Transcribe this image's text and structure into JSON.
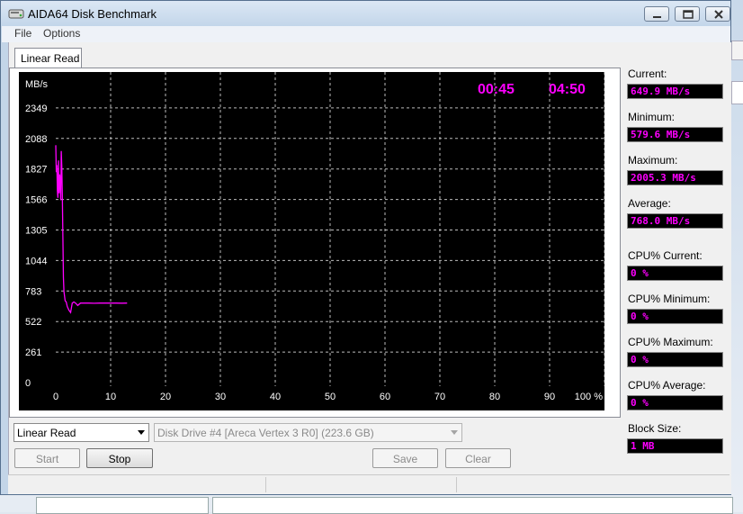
{
  "window": {
    "title": "AIDA64 Disk Benchmark"
  },
  "menu": {
    "file": "File",
    "options": "Options"
  },
  "tabs": [
    {
      "label": "Linear Read"
    }
  ],
  "chart": {
    "unit_label": "MB/s",
    "elapsed": "00:45",
    "remaining": "04:50",
    "line_color": "#ff00ff",
    "timer_color": "#ff00ff"
  },
  "chart_data": {
    "type": "line",
    "ylabel": "MB/s",
    "y_ticks": [
      "2349",
      "2088",
      "1827",
      "1566",
      "1305",
      "1044",
      "783",
      "522",
      "261",
      "0"
    ],
    "x_ticks": [
      "0",
      "10",
      "20",
      "30",
      "40",
      "50",
      "60",
      "70",
      "80",
      "90",
      "100 %"
    ],
    "xlim": [
      0,
      100
    ],
    "ylim": [
      0,
      2610
    ],
    "grid": true,
    "series": [
      {
        "x": [
          0,
          0.1,
          0.2,
          0.3,
          0.4,
          0.5,
          0.6,
          0.7,
          0.8,
          0.9,
          1.0,
          1.1,
          1.2,
          1.3,
          1.4,
          1.5,
          1.7,
          1.9,
          2.1,
          2.4,
          2.7,
          3.0,
          3.3,
          3.6,
          4.0,
          4.5,
          5.0,
          6.0,
          7.0,
          8.0,
          9.0,
          10.0,
          11.0,
          12.0,
          13.0
        ],
        "y": [
          2030,
          1800,
          1860,
          1640,
          1580,
          1900,
          1620,
          1780,
          1720,
          1560,
          1980,
          1850,
          1600,
          1250,
          900,
          780,
          700,
          690,
          650,
          620,
          600,
          680,
          690,
          680,
          660,
          680,
          680,
          680,
          678,
          680,
          680,
          680,
          680,
          679,
          680
        ]
      }
    ]
  },
  "stats": [
    {
      "label": "Current:",
      "value": "649.9 MB/s"
    },
    {
      "label": "Minimum:",
      "value": "579.6 MB/s"
    },
    {
      "label": "Maximum:",
      "value": "2005.3 MB/s"
    },
    {
      "label": "Average:",
      "value": "768.0 MB/s"
    },
    {
      "label": "CPU% Current:",
      "value": "0 %"
    },
    {
      "label": "CPU% Minimum:",
      "value": "0 %"
    },
    {
      "label": "CPU% Maximum:",
      "value": "0 %"
    },
    {
      "label": "CPU% Average:",
      "value": "0 %"
    },
    {
      "label": "Block Size:",
      "value": "1 MB"
    }
  ],
  "controls": {
    "test_select": "Linear Read",
    "drive_select": "Disk Drive #4  [Areca   Vertex 3 R0]  (223.6 GB)",
    "start": "Start",
    "stop": "Stop",
    "save": "Save",
    "clear": "Clear"
  }
}
